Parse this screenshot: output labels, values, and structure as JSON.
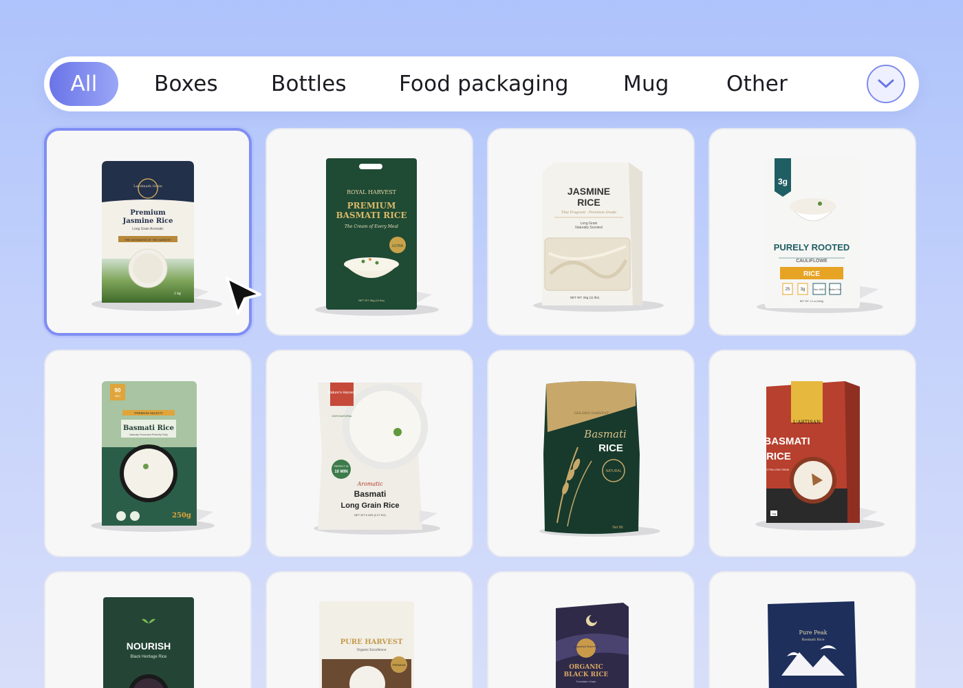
{
  "filters": {
    "items": [
      {
        "label": "All",
        "active": true
      },
      {
        "label": "Boxes",
        "active": false
      },
      {
        "label": "Bottles",
        "active": false
      },
      {
        "label": "Food packaging",
        "active": false
      },
      {
        "label": "Mug",
        "active": false
      },
      {
        "label": "Other",
        "active": false
      }
    ],
    "expand_icon": "chevron-down-icon"
  },
  "products": [
    {
      "brand": "Landmark Grain",
      "title1": "Premium",
      "title2": "Jasmine Rice",
      "subtitle": "Long Grain Aromatic",
      "ribbon": "THE GOODNESS OF THE HARVEST",
      "weight": "1 kg",
      "selected": true
    },
    {
      "brand": "ROYAL HARVEST",
      "title1": "PREMIUM",
      "title2": "BASMATI RICE",
      "subtitle": "The Cream of Every Meal",
      "badge": "ULTRA",
      "net": "NET WT. 5kg (11 lbs)"
    },
    {
      "title1": "JASMINE",
      "title2": "RICE",
      "subtitle": "Thai Fragrant · Premium Grade",
      "line1": "Long Grain",
      "line2": "Naturally Scented",
      "net": "NET WT. 5kg (11 lbs)"
    },
    {
      "badge": "3g",
      "title1": "PURELY ROOTED",
      "title2": "CAULIFLOWE",
      "title3": "RICE",
      "facts": [
        "25",
        "3g",
        "Non-GMO",
        "Gluten Free"
      ],
      "net": "NET WT. 12 oz (340g)"
    },
    {
      "badge": "90",
      "badge_unit": "SEC",
      "ribbon": "PREMIUM SELECTI",
      "title": "Basmati Rice",
      "subtitle": "Naturally Fermented Perfectly Fluffy",
      "weight": "250g"
    },
    {
      "brand": "Nature's Harvest",
      "tag": "100% NATURAL",
      "time": "10 MIN",
      "time_label": "PERFECT IN",
      "script": "Aromatic",
      "title1": "Basmati",
      "title2": "Long Grain Rice",
      "net": "NET WT 5 LBS (2.27 KG)"
    },
    {
      "brand": "GOLDEN HARVEST",
      "title1": "Basmati",
      "title2": "RICE",
      "badge": "NATURAL",
      "net": "Net Wt"
    },
    {
      "brand": "L'ARTISAN",
      "title1": "BASMATI",
      "title2": "RICE",
      "side": "EXTRA LONG GRAIN",
      "weight": "1kg"
    },
    {
      "title": "NOURISH",
      "subtitle": "Black Heritage Rice"
    },
    {
      "title": "PURE HARVEST",
      "subtitle": "Organic Excellence",
      "badge": "PREMIUM"
    },
    {
      "brand": "Imperial Harvest",
      "title1": "ORGANIC",
      "title2": "BLACK RICE",
      "subtitle": "Forbidden Grain"
    },
    {
      "title": "Pure Peak",
      "subtitle": "Basmati Rice"
    }
  ],
  "colors": {
    "accent": "#7f8ef2",
    "chip_active_start": "#6a74e8",
    "chip_active_end": "#9aa6f6"
  }
}
